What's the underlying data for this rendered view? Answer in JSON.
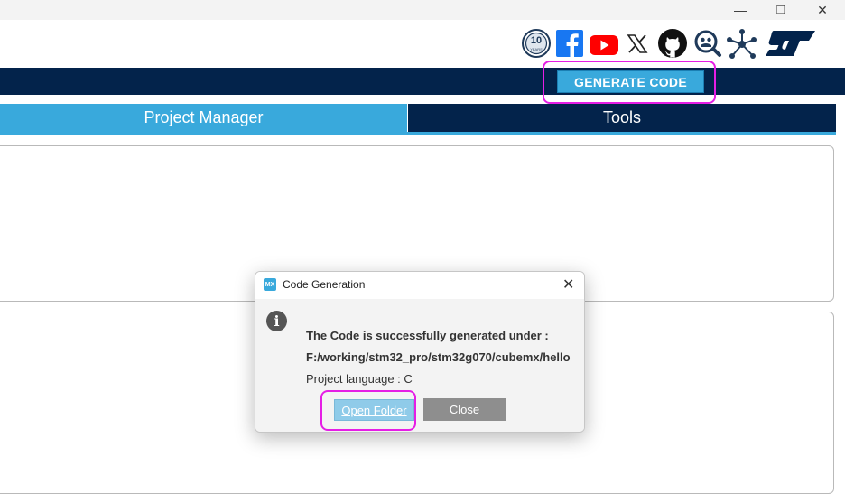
{
  "window": {
    "minimize": "—",
    "restore": "❐",
    "close": "✕"
  },
  "social_icons": [
    "anniversary-10-years-icon",
    "facebook-icon",
    "youtube-icon",
    "x-icon",
    "github-icon",
    "community-search-icon",
    "network-icon",
    "st-logo-icon"
  ],
  "social_texts": {
    "anniversary": "10",
    "anniversary_sub": "YEARS"
  },
  "toolbar": {
    "generate_label": "GENERATE CODE"
  },
  "tabs": [
    {
      "label": "Project Manager",
      "active": true
    },
    {
      "label": "Tools",
      "active": false
    }
  ],
  "colors": {
    "accent": "#39a9dc",
    "navy": "#03234b",
    "highlight": "#e51ee5",
    "close_button": "#8e8e8e"
  },
  "dialog": {
    "logo": "MX",
    "title": "Code Generation",
    "close_glyph": "✕",
    "info_glyph": "i",
    "message_line1": "The Code is successfully generated under :",
    "message_path": "F:/working/stm32_pro/stm32g070/cubemx/hello",
    "message_language": "Project language : C",
    "open_folder_label": "Open Folder",
    "close_label": "Close"
  }
}
